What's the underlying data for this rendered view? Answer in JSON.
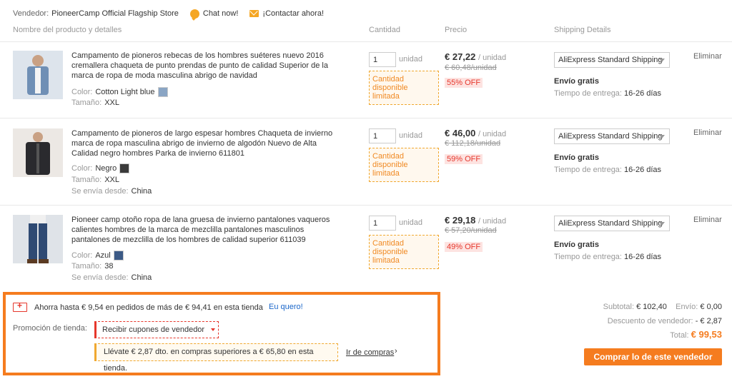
{
  "vendor": {
    "label": "Vendedor:",
    "name": "PioneerCamp Official Flagship Store",
    "chat_label": "Chat now!",
    "contact_label": "¡Contactar ahora!"
  },
  "columns": {
    "name": "Nombre del producto y detalles",
    "quantity": "Cantidad",
    "price": "Precio",
    "shipping": "Shipping Details"
  },
  "items": [
    {
      "title": "Campamento de pioneros rebecas de los hombres suéteres nuevo 2016 cremallera chaqueta de punto prendas de punto de calidad Superior de la marca de ropa de moda masculina abrigo de navidad",
      "color_label": "Color:",
      "color": "Cotton Light blue",
      "size_label": "Tamaño:",
      "size": "XXL",
      "qty": "1",
      "unit": "unidad",
      "stock_note": "Cantidad disponible limitada",
      "price": "€ 27,22",
      "per_unit": "/ unidad",
      "original": "€ 60,48/unidad",
      "discount": "55% OFF",
      "shipping_method": "AliExpress Standard Shipping",
      "free_shipping": "Envío gratis",
      "delivery_label": "Tiempo de entrega:",
      "delivery": "16-26 días",
      "remove": "Eliminar",
      "thumb_color": "#6f8fb5",
      "swatch_color": "#8aa5c4"
    },
    {
      "title": "Campamento de pioneros de largo espesar hombres Chaqueta de invierno marca de ropa masculina abrigo de invierno de algodón Nuevo de Alta Calidad negro hombres Parka de invierno 611801",
      "color_label": "Color:",
      "color": "Negro",
      "size_label": "Tamaño:",
      "size": "XXL",
      "ships_label": "Se envía desde:",
      "ships_from": "China",
      "qty": "1",
      "unit": "unidad",
      "stock_note": "Cantidad disponible limitada",
      "price": "€ 46,00",
      "per_unit": "/ unidad",
      "original": "€ 112,18/unidad",
      "discount": "59% OFF",
      "shipping_method": "AliExpress Standard Shipping",
      "free_shipping": "Envío gratis",
      "delivery_label": "Tiempo de entrega:",
      "delivery": "16-26 días",
      "remove": "Eliminar",
      "thumb_color": "#2a2a2e",
      "swatch_color": "#3a3a3a"
    },
    {
      "title": "Pioneer camp otoño ropa de lana gruesa de invierno pantalones vaqueros calientes hombres de la marca de mezclilla pantalones masculinos pantalones de mezclilla de los hombres de calidad superior 611039",
      "color_label": "Color:",
      "color": "Azul",
      "size_label": "Tamaño:",
      "size": "38",
      "ships_label": "Se envía desde:",
      "ships_from": "China",
      "qty": "1",
      "unit": "unidad",
      "stock_note": "Cantidad disponible limitada",
      "price": "€ 29,18",
      "per_unit": "/ unidad",
      "original": "€ 57,20/unidad",
      "discount": "49% OFF",
      "shipping_method": "AliExpress Standard Shipping",
      "free_shipping": "Envío gratis",
      "delivery_label": "Tiempo de entrega:",
      "delivery": "16-26 días",
      "remove": "Eliminar",
      "thumb_color": "#2f4a73",
      "swatch_color": "#3c5a86"
    }
  ],
  "promo": {
    "save_text": "Ahorra hasta € 9,54 en pedidos de más de € 94,41 en esta tienda",
    "want_link": "Eu quero!",
    "store_promo_label": "Promoción de tienda:",
    "coupon_dropdown": "Recibir cupones de vendedor",
    "discount_text": "Llévate € 2,87 dto. en compras superiores a € 65,80 en esta tienda.",
    "shop_link": "Ir de compras",
    "shop_chevron": "›"
  },
  "summary": {
    "subtotal_label": "Subtotal:",
    "subtotal": "€ 102,40",
    "shipping_label": "Envío:",
    "shipping": "€ 0,00",
    "vendor_discount_label": "Descuento de vendedor:",
    "vendor_discount": "- € 2,87",
    "total_label": "Total:",
    "total": "€ 99,53",
    "buy_button": "Comprar lo de este vendedor"
  },
  "colors": {
    "accent": "#f57c1f",
    "discount_red": "#e6372c",
    "link_blue": "#1a66c9"
  }
}
